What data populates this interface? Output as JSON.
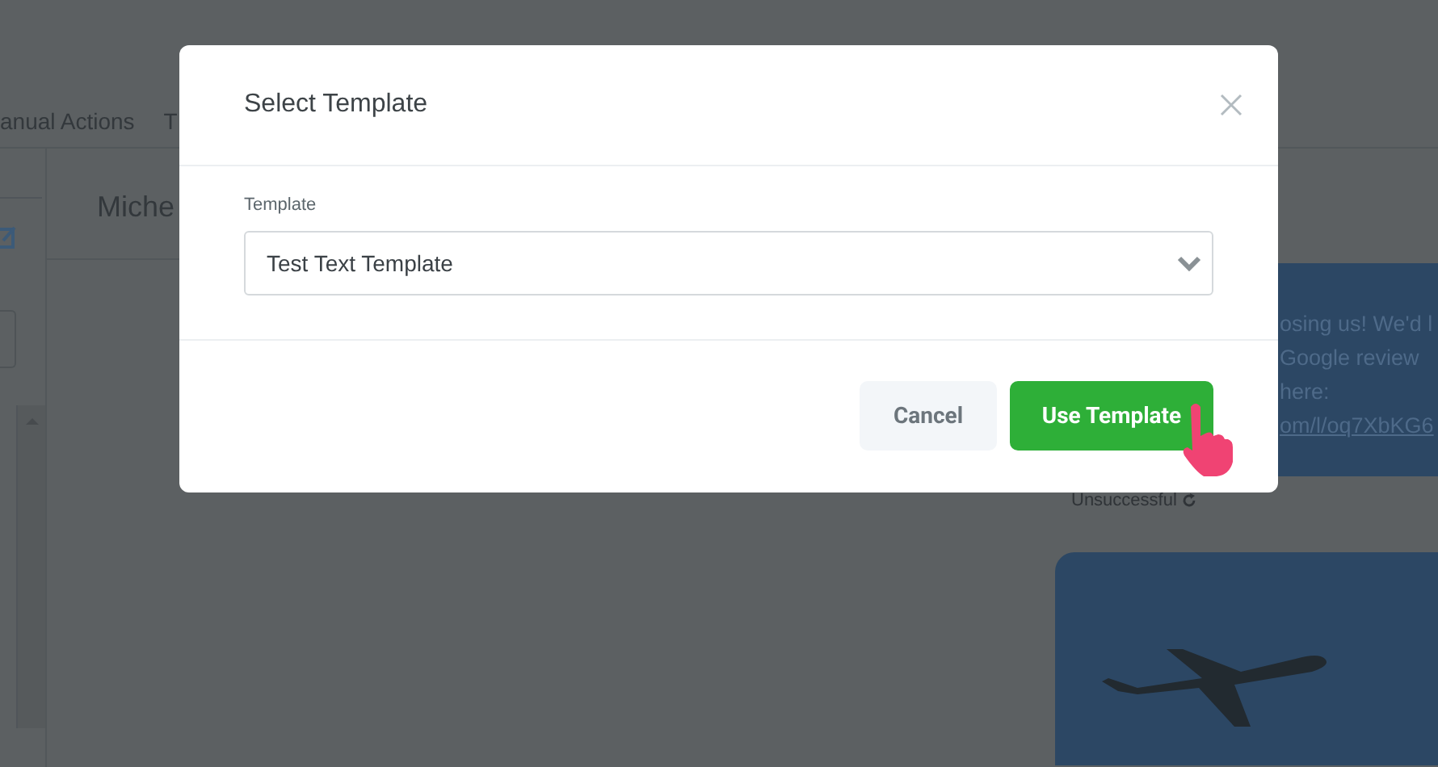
{
  "background": {
    "nav_tabs": [
      "anual Actions",
      "T"
    ],
    "contact_name": "Miche",
    "message": {
      "lines": [
        "osing us! We'd l",
        "Google review",
        "here:"
      ],
      "link": "om/l/oq7XbKG6"
    },
    "message_status": "Unsuccessful"
  },
  "modal": {
    "title": "Select Template",
    "field": {
      "label": "Template",
      "value": "Test Text Template"
    },
    "buttons": [
      {
        "label": "Cancel",
        "kind": "secondary"
      },
      {
        "label": "Use Template",
        "kind": "primary"
      }
    ]
  }
}
